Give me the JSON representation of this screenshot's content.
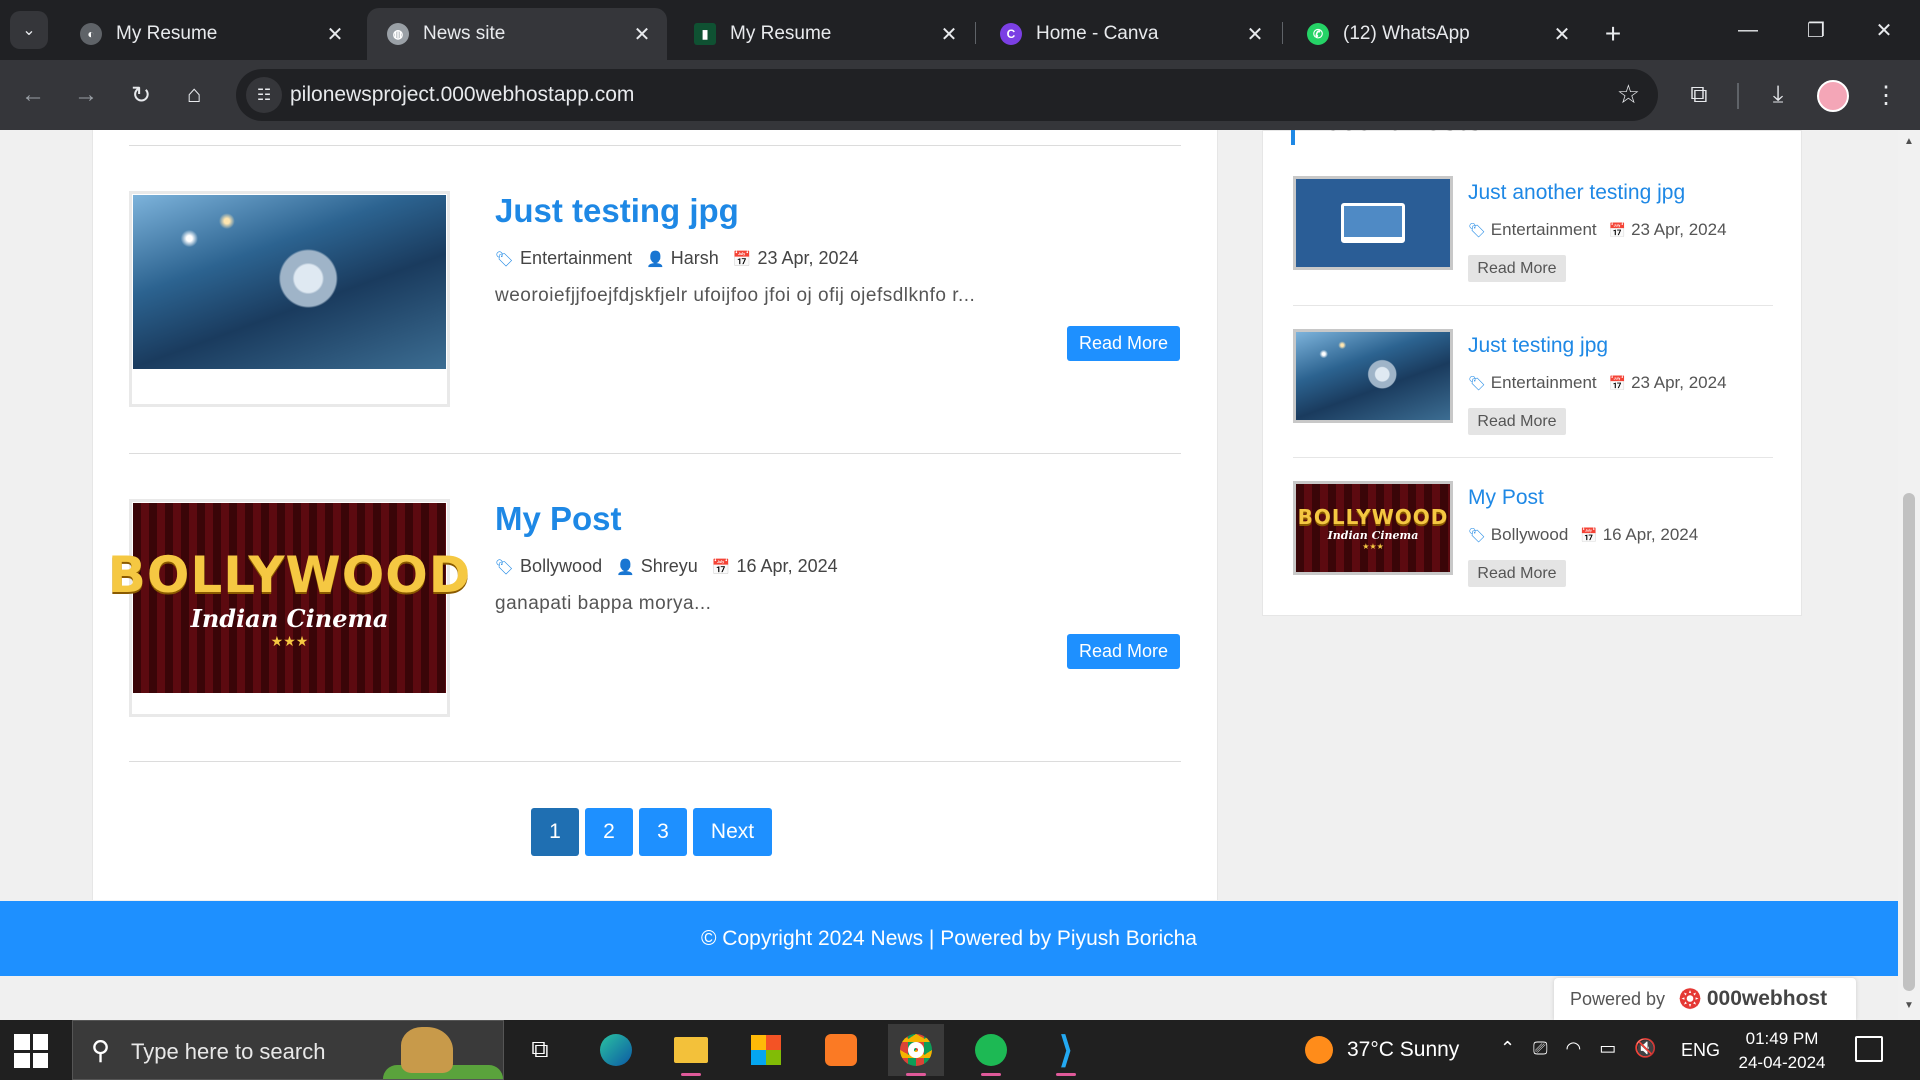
{
  "browser": {
    "tabs": [
      {
        "title": "My Resume",
        "active": false,
        "favicon_color": "#5f6368"
      },
      {
        "title": "News site",
        "active": true,
        "favicon_color": "#9aa0a6"
      },
      {
        "title": "My Resume",
        "active": false,
        "favicon_color": "#0f5132"
      },
      {
        "title": "Home - Canva",
        "active": false,
        "favicon_color": "#7b3fe4"
      },
      {
        "title": "(12) WhatsApp",
        "active": false,
        "favicon_color": "#25d366"
      }
    ],
    "url": "pilonewsproject.000webhostapp.com"
  },
  "posts": [
    {
      "title": "Just testing jpg",
      "category": "Entertainment",
      "author": "Harsh",
      "date": "23 Apr, 2024",
      "excerpt": "weoroiefjjfoejfdjskfjelr ufoijfoo jfoi oj ofij ojefsdlknfo r...",
      "read_more": "Read More",
      "image": "globe-keyboard"
    },
    {
      "title": "My Post",
      "category": "Bollywood",
      "author": "Shreyu",
      "date": "16 Apr, 2024",
      "excerpt": "ganapati bappa morya...",
      "read_more": "Read More",
      "image": "bollywood"
    }
  ],
  "image_text": {
    "bollywood_main": "BOLLYWOOD",
    "bollywood_sub": "Indian Cinema",
    "bollywood_stars": "★★★"
  },
  "pagination": {
    "pages": [
      "1",
      "2",
      "3"
    ],
    "current": "1",
    "next": "Next"
  },
  "sidebar": {
    "heading": "Recent Posts",
    "items": [
      {
        "title": "Just another testing jpg",
        "category": "Entertainment",
        "date": "23 Apr, 2024",
        "read_more": "Read More",
        "image": "laptop"
      },
      {
        "title": "Just testing jpg",
        "category": "Entertainment",
        "date": "23 Apr, 2024",
        "read_more": "Read More",
        "image": "globe-keyboard"
      },
      {
        "title": "My Post",
        "category": "Bollywood",
        "date": "16 Apr, 2024",
        "read_more": "Read More",
        "image": "bollywood"
      }
    ]
  },
  "footer": {
    "text": "© Copyright 2024 News | Powered by Piyush Boricha"
  },
  "host_badge": {
    "label": "Powered by",
    "brand": "000webhost"
  },
  "taskbar": {
    "search_placeholder": "Type here to search",
    "weather": "37°C  Sunny",
    "language": "ENG",
    "time": "01:49 PM",
    "date": "24-04-2024"
  },
  "colors": {
    "accent": "#1e90ff",
    "title_blue": "#1e88e5",
    "active_page": "#1f6fb2"
  }
}
